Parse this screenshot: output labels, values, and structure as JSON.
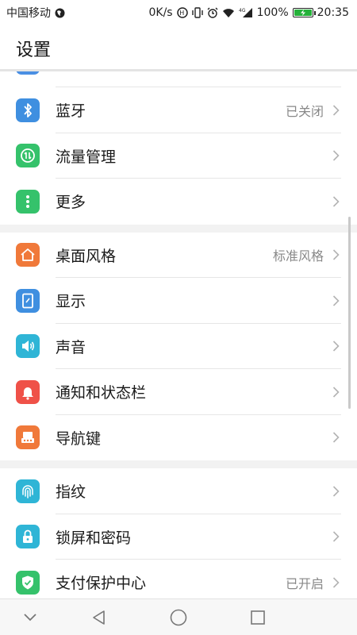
{
  "status_bar": {
    "carrier": "中国移动",
    "speed": "0K/s",
    "network": "4G",
    "battery": "100%",
    "time": "20:35"
  },
  "header": {
    "title": "设置"
  },
  "groups": [
    {
      "items": [
        {
          "label": "蓝牙",
          "value": "已关闭",
          "icon": "bluetooth-icon",
          "color": "#3f8fe0"
        },
        {
          "label": "流量管理",
          "value": "",
          "icon": "data-usage-icon",
          "color": "#35c26b"
        },
        {
          "label": "更多",
          "value": "",
          "icon": "more-icon",
          "color": "#35c26b"
        }
      ]
    },
    {
      "items": [
        {
          "label": "桌面风格",
          "value": "标准风格",
          "icon": "home-icon",
          "color": "#f0793a"
        },
        {
          "label": "显示",
          "value": "",
          "icon": "display-icon",
          "color": "#3f8fe0"
        },
        {
          "label": "声音",
          "value": "",
          "icon": "sound-icon",
          "color": "#2fb5d6"
        },
        {
          "label": "通知和状态栏",
          "value": "",
          "icon": "bell-icon",
          "color": "#ef5148"
        },
        {
          "label": "导航键",
          "value": "",
          "icon": "navigation-keys-icon",
          "color": "#f0793a"
        }
      ]
    },
    {
      "items": [
        {
          "label": "指纹",
          "value": "",
          "icon": "fingerprint-icon",
          "color": "#2fb5d6"
        },
        {
          "label": "锁屏和密码",
          "value": "",
          "icon": "lock-icon",
          "color": "#2fb5d6"
        },
        {
          "label": "支付保护中心",
          "value": "已开启",
          "icon": "shield-check-icon",
          "color": "#35c26b"
        }
      ]
    }
  ]
}
